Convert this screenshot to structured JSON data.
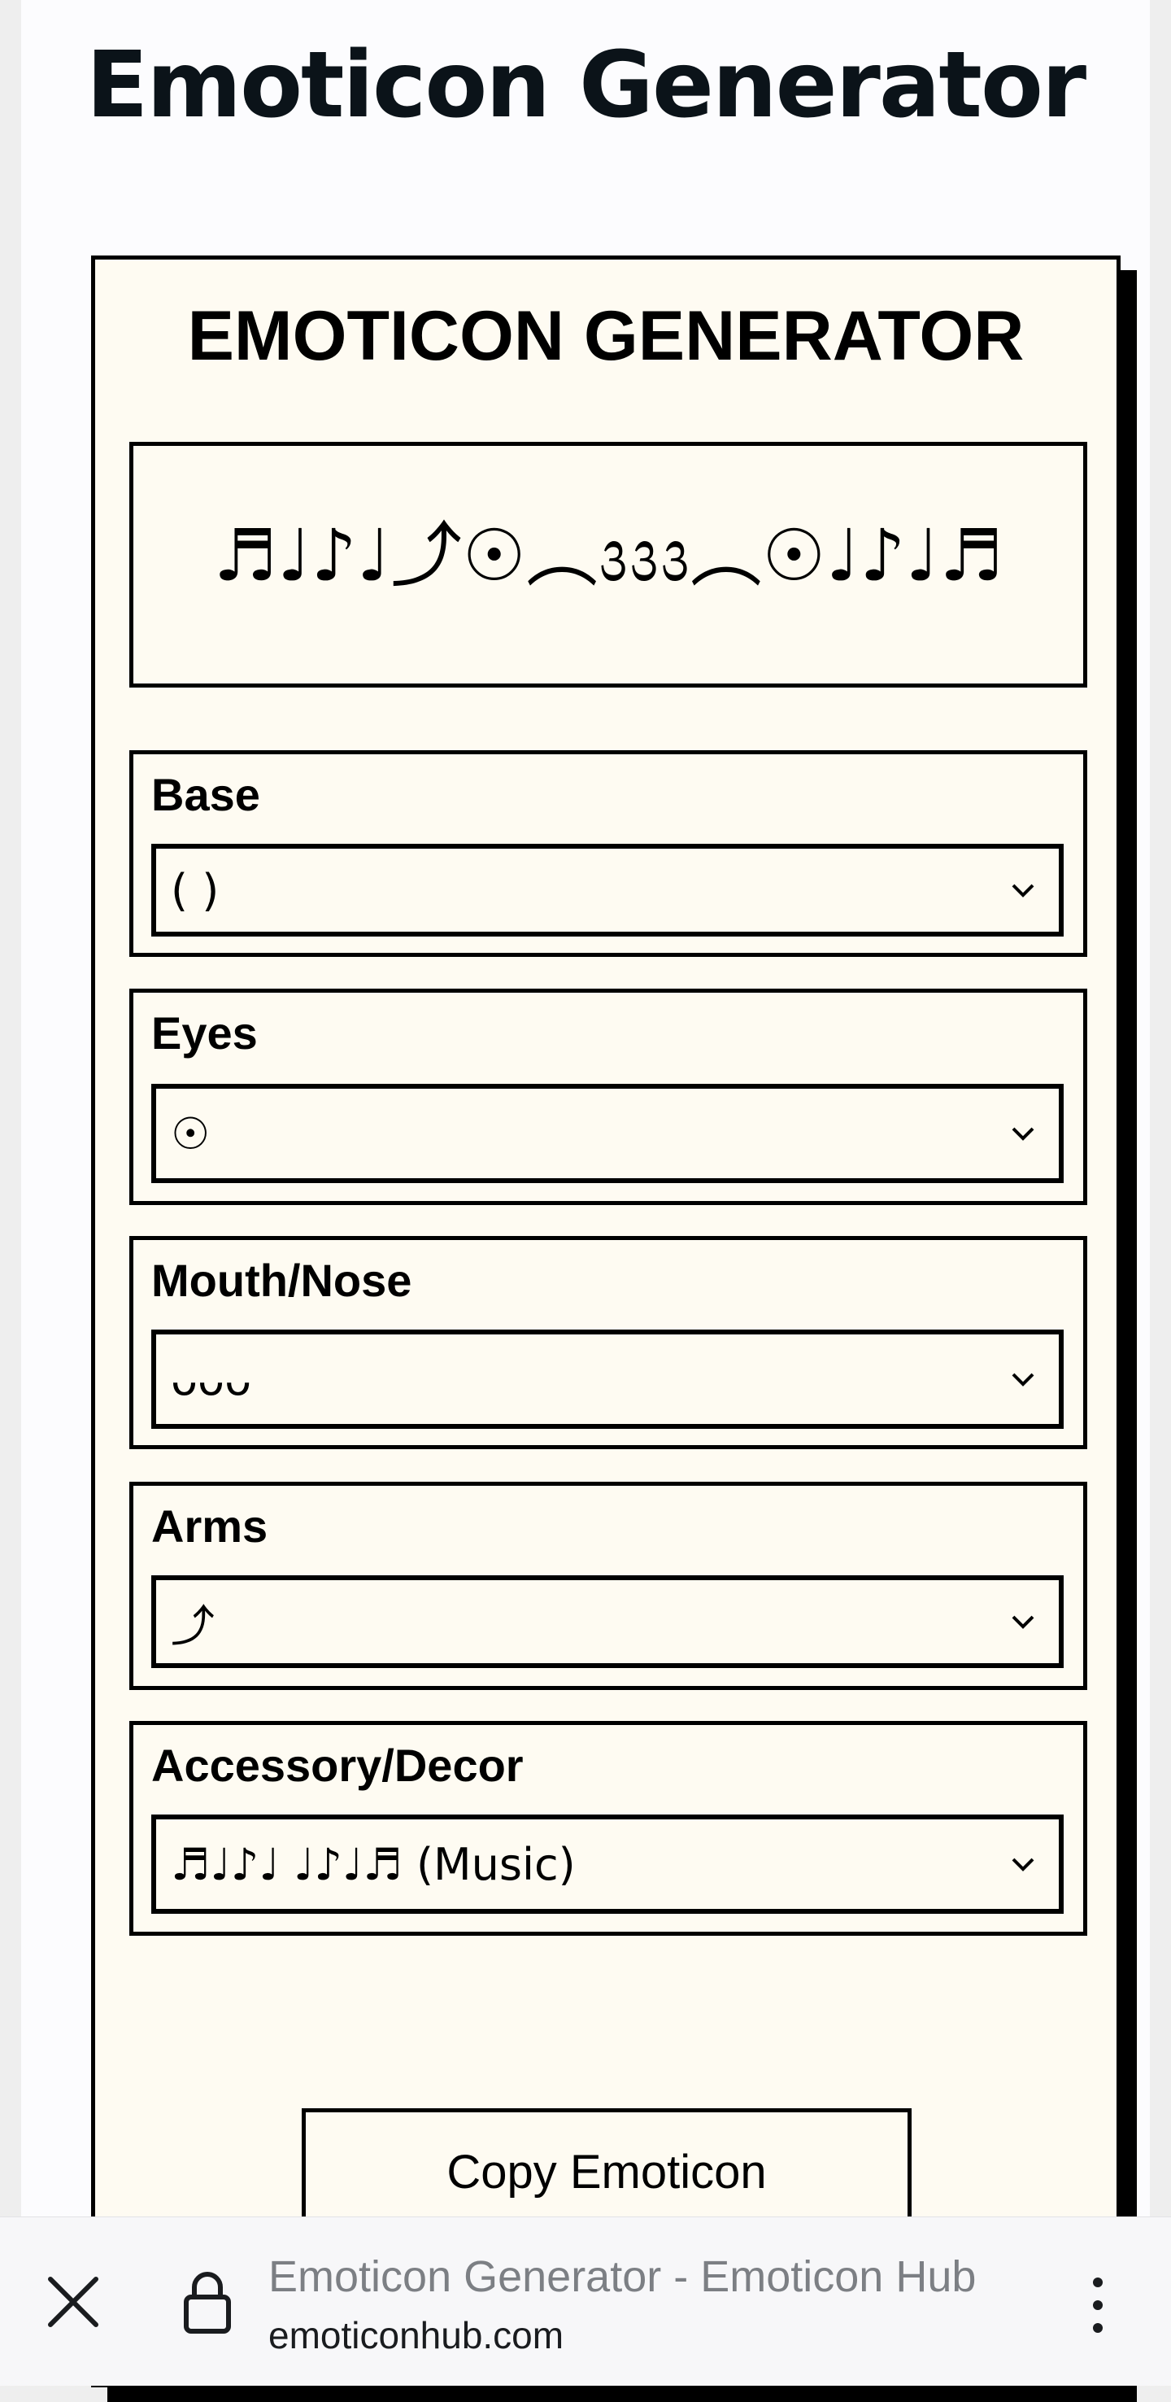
{
  "page": {
    "title": "Emoticon Generator"
  },
  "generator": {
    "heading": "EMOTICON GENERATOR",
    "preview": "♬♩♪♩⤴☉︵᭠᭠᭠︵☉♩♪♩♬",
    "fields": [
      {
        "label": "Base",
        "value": "( )"
      },
      {
        "label": "Eyes",
        "value": "☉"
      },
      {
        "label": "Mouth/Nose",
        "value": "ᴗᴗᴗ"
      },
      {
        "label": "Arms",
        "value": "⤴"
      },
      {
        "label": "Accessory/Decor",
        "value": "♬♩♪♩ ♩♪♩♬ (Music)"
      }
    ],
    "copy_label": "Copy Emoticon"
  },
  "browser": {
    "page_title": "Emoticon Generator - Emoticon Hub",
    "domain": "emoticonhub.com"
  },
  "icons": {
    "close": "close-icon",
    "lock": "lock-icon",
    "menu": "more-vert-icon",
    "chevron": "chevron-down-icon"
  }
}
